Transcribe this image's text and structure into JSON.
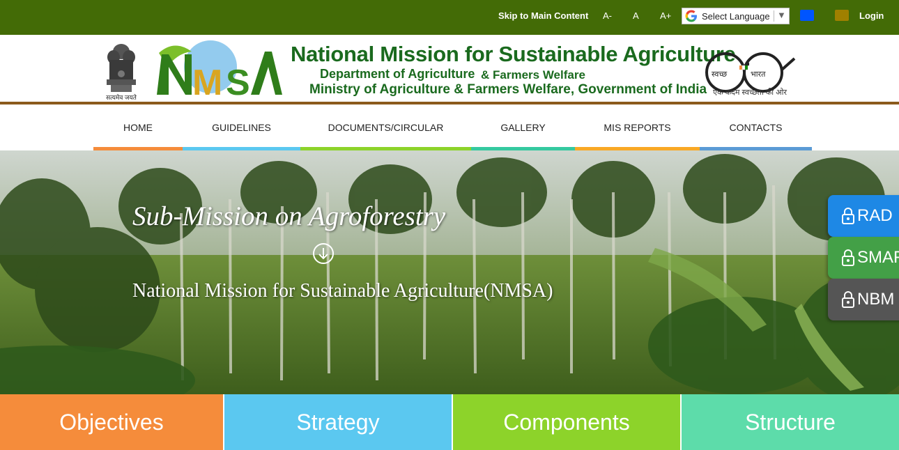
{
  "topbar": {
    "skip_label": "Skip to Main Content",
    "font_decrease": "A-",
    "font_normal": "A",
    "font_increase": "A+",
    "language_select": "Select Language",
    "theme_colors": [
      "#0055ff",
      "#a08000"
    ],
    "login_label": "Login",
    "bg_color": "#436b06"
  },
  "header": {
    "emblem_caption": "सत्यमेव जयते",
    "logo_text": "NMSA",
    "title": "National Mission for Sustainable Agriculture",
    "department": "Department of Agriculture",
    "department_suffix": "& Farmers Welfare",
    "ministry": "Ministry of Agriculture & Farmers Welfare, Government of India",
    "swachh_left": "स्वच्छ",
    "swachh_right": "भारत",
    "swachh_caption": "एक कदम स्वच्छता की ओर"
  },
  "nav": {
    "items": [
      {
        "label": "HOME",
        "color": "#f58c3b"
      },
      {
        "label": "GUIDELINES",
        "color": "#5bc8f0"
      },
      {
        "label": "DOCUMENTS/CIRCULAR",
        "color": "#8dd32a"
      },
      {
        "label": "GALLERY",
        "color": "#35c9a0"
      },
      {
        "label": "MIS REPORTS",
        "color": "#f9a825"
      },
      {
        "label": "CONTACTS",
        "color": "#5b9bd5"
      }
    ]
  },
  "hero": {
    "title": "Sub-Mission on Agroforestry",
    "subtitle": "National Mission for Sustainable Agriculture(NMSA)",
    "scroll_icon": "arrow-down-circle-icon"
  },
  "side_buttons": [
    {
      "label": "RAD",
      "color": "#1e88e5"
    },
    {
      "label": "SMAF",
      "color": "#43a047"
    },
    {
      "label": "NBM",
      "color": "#555555"
    }
  ],
  "tiles": [
    {
      "label": "Objectives",
      "color": "#f58c3b"
    },
    {
      "label": "Strategy",
      "color": "#5bc8f0"
    },
    {
      "label": "Components",
      "color": "#8dd32a"
    },
    {
      "label": "Structure",
      "color": "#5ddcaa"
    }
  ]
}
